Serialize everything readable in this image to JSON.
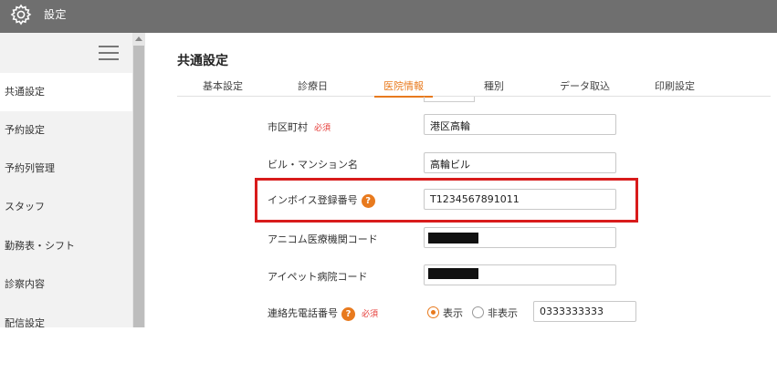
{
  "header": {
    "title": "設定"
  },
  "sidebar": {
    "items": [
      {
        "label": "共通設定",
        "active": true
      },
      {
        "label": "予約設定",
        "active": false
      },
      {
        "label": "予約列管理",
        "active": false
      },
      {
        "label": "スタッフ",
        "active": false
      },
      {
        "label": "勤務表・シフト",
        "active": false
      },
      {
        "label": "診察内容",
        "active": false
      },
      {
        "label": "配信設定",
        "active": false
      }
    ]
  },
  "main": {
    "title": "共通設定",
    "tabs": [
      {
        "label": "基本設定"
      },
      {
        "label": "診療日"
      },
      {
        "label": "医院情報",
        "active": true
      },
      {
        "label": "種別"
      },
      {
        "label": "データ取込"
      },
      {
        "label": "印刷設定"
      }
    ],
    "fields": {
      "city": {
        "label": "市区町村",
        "required": "必須",
        "value": "港区高輪"
      },
      "building": {
        "label": "ビル・マンション名",
        "value": "高輪ビル"
      },
      "invoice": {
        "label": "インボイス登録番号",
        "help": "?",
        "value": "T1234567891011"
      },
      "anicom": {
        "label": "アニコム医療機関コード",
        "value": ""
      },
      "ipet": {
        "label": "アイペット病院コード",
        "value": ""
      },
      "phone": {
        "label": "連絡先電話番号",
        "help": "?",
        "required": "必須",
        "options": [
          "表示",
          "非表示"
        ],
        "selected": "表示",
        "value": "0333333333"
      }
    }
  },
  "colors": {
    "accent": "#e87a1e",
    "highlight": "#d81b1b",
    "topbar": "#6f6f6f"
  }
}
